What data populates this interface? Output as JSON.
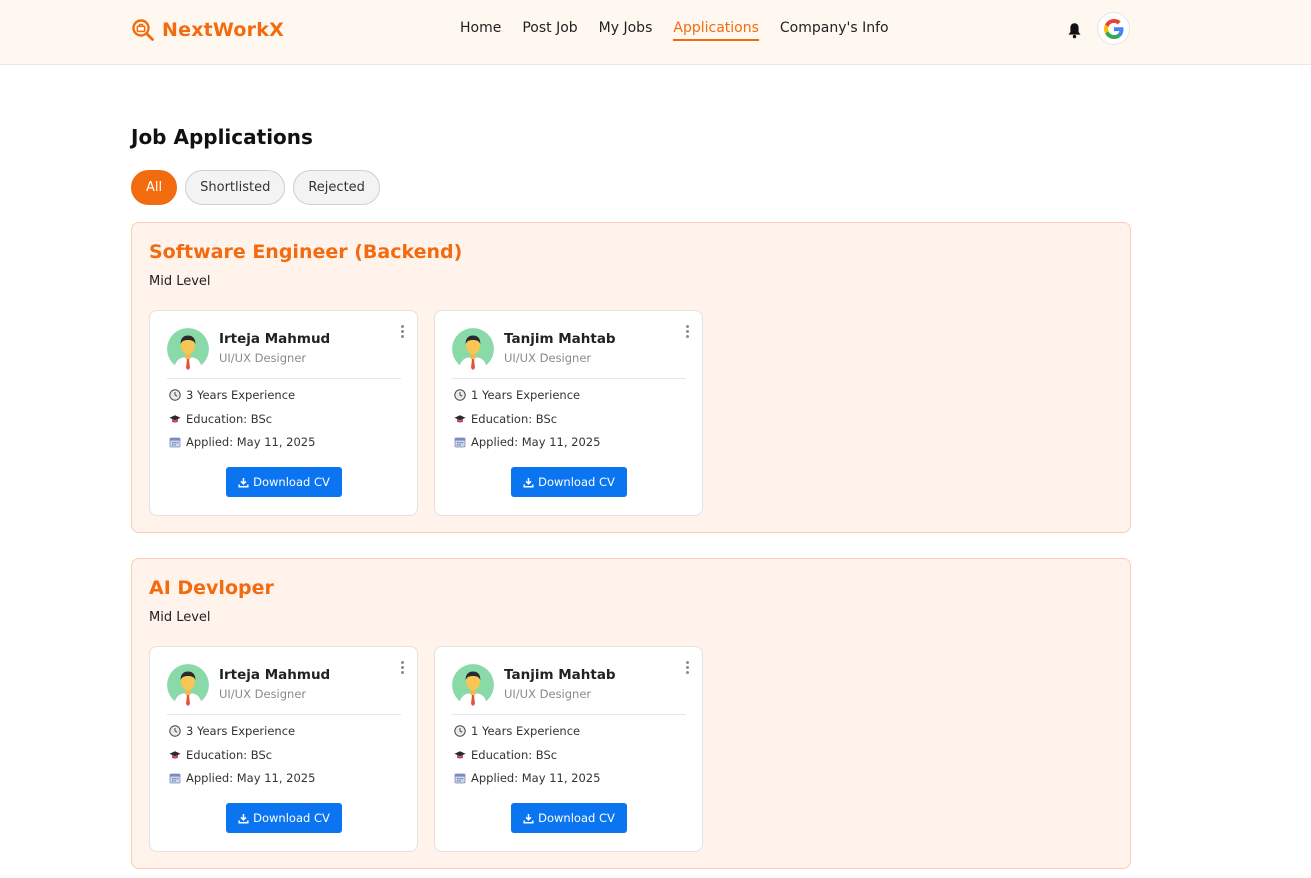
{
  "brand": {
    "name": "NextWorkX",
    "accent": "#f26b0f"
  },
  "nav": {
    "items": [
      "Home",
      "Post Job",
      "My Jobs",
      "Applications",
      "Company's Info"
    ],
    "active": "Applications"
  },
  "header_icons": [
    "bell-icon",
    "google-avatar-icon"
  ],
  "page": {
    "title": "Job Applications",
    "filters": [
      "All",
      "Shortlisted",
      "Rejected"
    ],
    "active_filter": "All"
  },
  "jobs": [
    {
      "title": "Software Engineer (Backend)",
      "level": "Mid Level",
      "applicants": [
        {
          "name": "Irteja Mahmud",
          "role": "UI/UX Designer",
          "experience": "3 Years Experience",
          "education": "Education: BSc",
          "applied": "Applied: May 11, 2025",
          "button": "Download CV"
        },
        {
          "name": "Tanjim Mahtab",
          "role": "UI/UX Designer",
          "experience": "1 Years Experience",
          "education": "Education: BSc",
          "applied": "Applied: May 11, 2025",
          "button": "Download CV"
        }
      ]
    },
    {
      "title": "AI Devloper",
      "level": "Mid Level",
      "applicants": [
        {
          "name": "Irteja Mahmud",
          "role": "UI/UX Designer",
          "experience": "3 Years Experience",
          "education": "Education: BSc",
          "applied": "Applied: May 11, 2025",
          "button": "Download CV"
        },
        {
          "name": "Tanjim Mahtab",
          "role": "UI/UX Designer",
          "experience": "1 Years Experience",
          "education": "Education: BSc",
          "applied": "Applied: May 11, 2025",
          "button": "Download CV"
        }
      ]
    }
  ]
}
